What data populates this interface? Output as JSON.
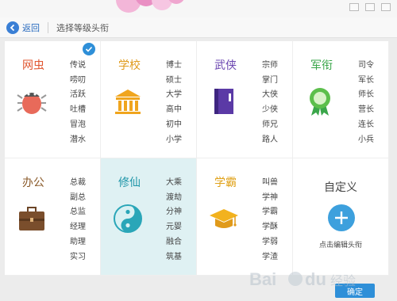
{
  "header": {
    "back_label": "返回",
    "title": "选择等级头衔"
  },
  "colors": {
    "accent": "#2e8fd8",
    "selected_bg": "#dff1f3"
  },
  "cells": [
    {
      "title": "网虫",
      "title_color": "#e0552f",
      "icon": "bug-icon",
      "items": [
        "传说",
        "唠叨",
        "活跃",
        "吐槽",
        "冒泡",
        "潜水"
      ],
      "checked": true
    },
    {
      "title": "学校",
      "title_color": "#e09a1a",
      "icon": "school-building-icon",
      "items": [
        "博士",
        "硕士",
        "大学",
        "高中",
        "初中",
        "小学"
      ]
    },
    {
      "title": "武侠",
      "title_color": "#6a45b0",
      "icon": "book-icon",
      "items": [
        "宗师",
        "掌门",
        "大侠",
        "少侠",
        "师兄",
        "路人"
      ]
    },
    {
      "title": "军衔",
      "title_color": "#3aa64a",
      "icon": "medal-icon",
      "items": [
        "司令",
        "军长",
        "师长",
        "营长",
        "连长",
        "小兵"
      ]
    },
    {
      "title": "办公",
      "title_color": "#8a5a2a",
      "icon": "briefcase-icon",
      "items": [
        "总裁",
        "副总",
        "总监",
        "经理",
        "助理",
        "实习"
      ]
    },
    {
      "title": "修仙",
      "title_color": "#1e95a8",
      "icon": "taiji-icon",
      "items": [
        "大乘",
        "渡劫",
        "分神",
        "元婴",
        "融合",
        "筑基"
      ],
      "selected": true
    },
    {
      "title": "学霸",
      "title_color": "#e0a21a",
      "icon": "graduation-cap-icon",
      "items": [
        "叫兽",
        "学神",
        "学霸",
        "学酥",
        "学弱",
        "学渣"
      ]
    }
  ],
  "custom": {
    "title": "自定义",
    "hint": "点击编辑头衔"
  },
  "footer": {
    "confirm_label": "确定"
  },
  "watermark": "Bai du 经验"
}
